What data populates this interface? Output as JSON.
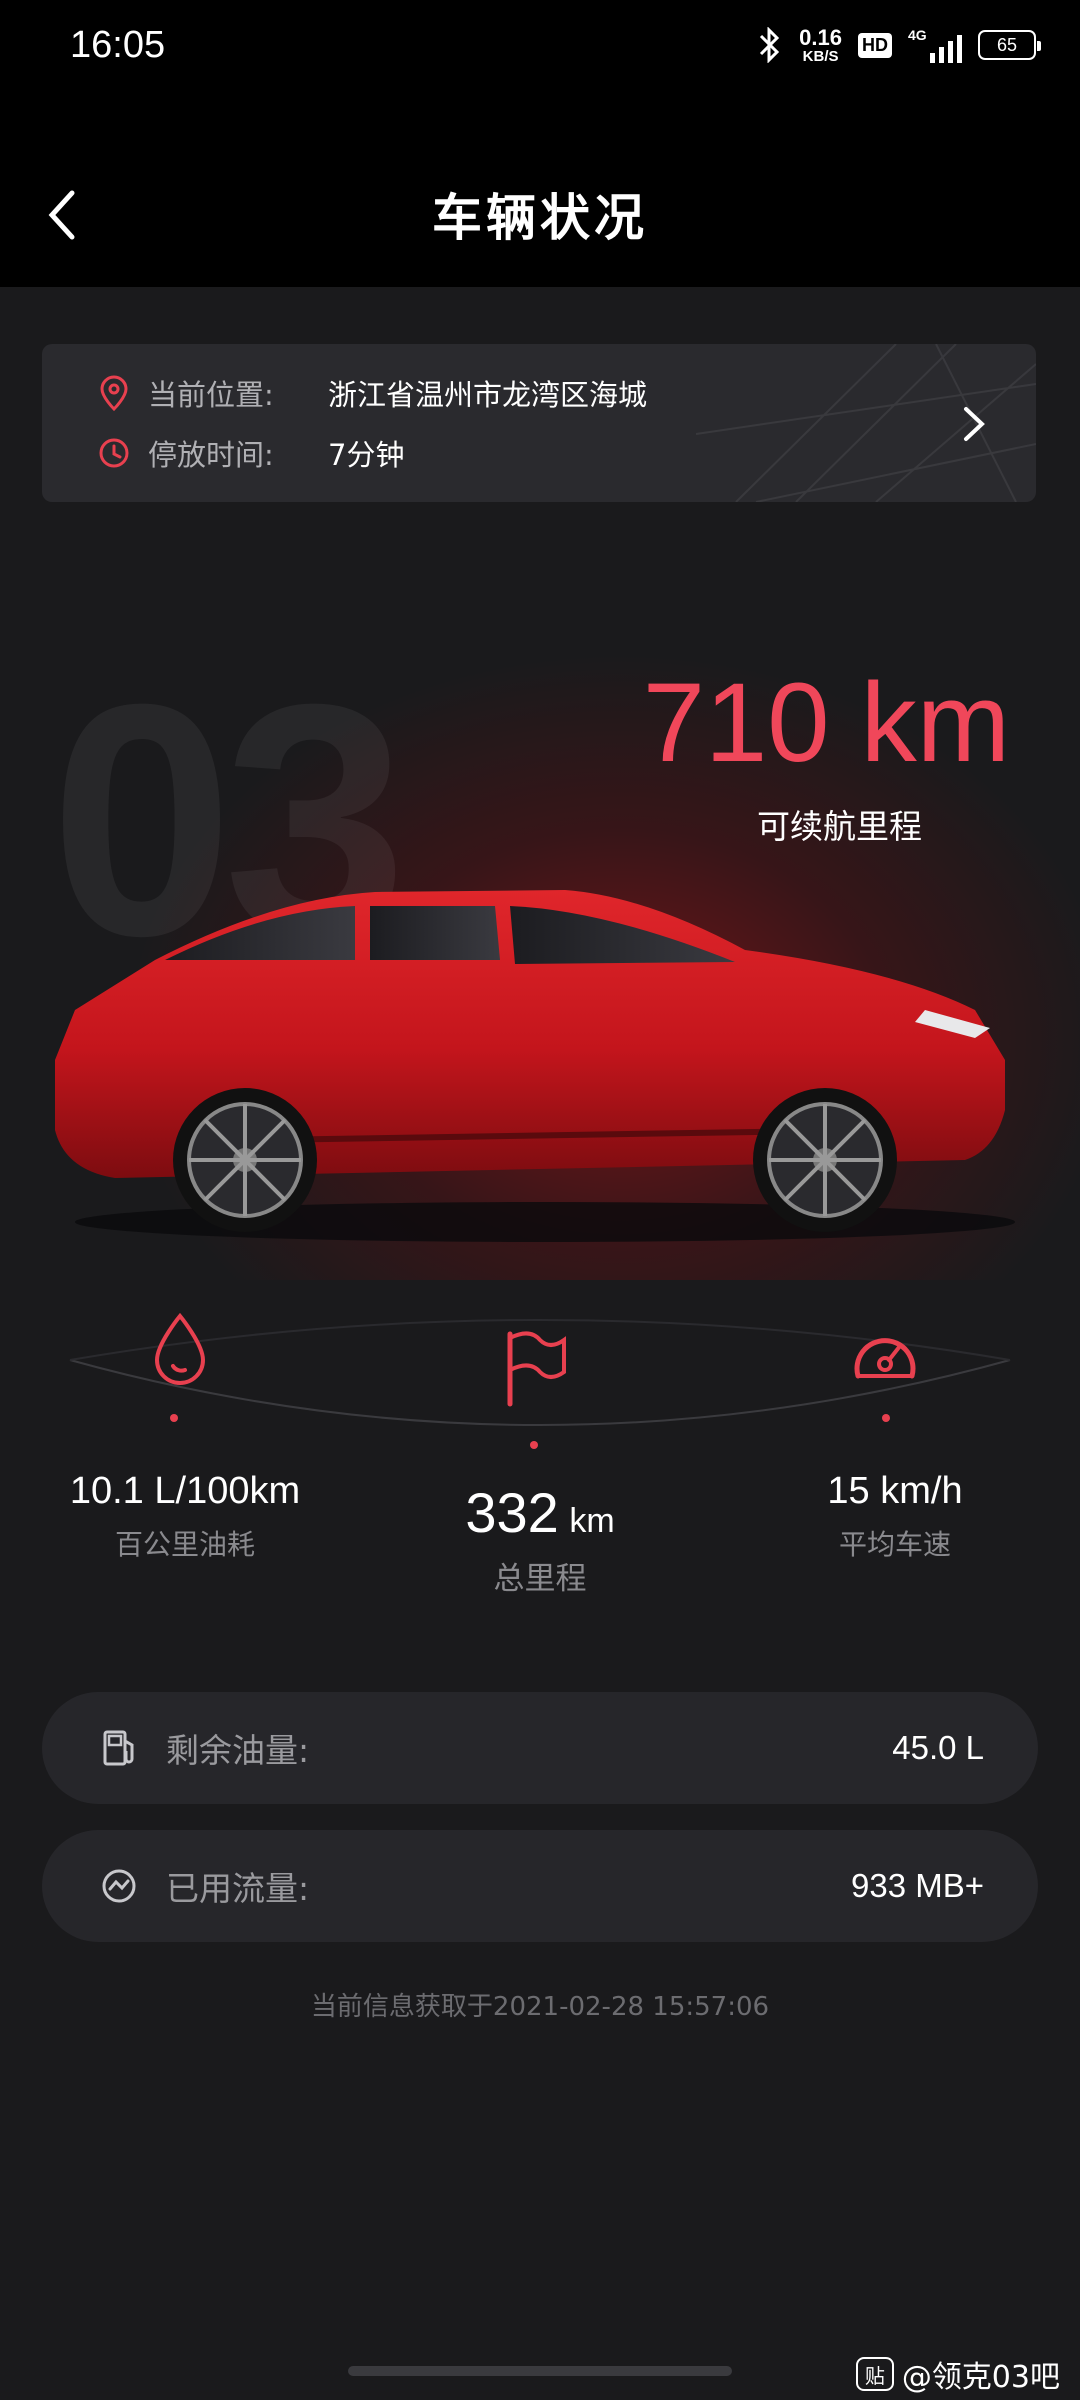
{
  "status_bar": {
    "time": "16:05",
    "net_speed_value": "0.16",
    "net_speed_unit": "KB/S",
    "hd_label": "HD",
    "signal_label": "4G",
    "battery_level": "65"
  },
  "header": {
    "title": "车辆状况",
    "back_icon": "chevron-left-icon"
  },
  "location_card": {
    "location_label": "当前位置:",
    "location_value": "浙江省温州市龙湾区海城",
    "parking_label": "停放时间:",
    "parking_value": "7分钟",
    "location_icon": "map-pin-icon",
    "clock_icon": "clock-icon",
    "arrow_icon": "chevron-right-icon"
  },
  "hero": {
    "watermark": "03",
    "range_value": "710 km",
    "range_label": "可续航里程",
    "accent_color": "#f0475a"
  },
  "stats": {
    "fuel_consumption": {
      "value": "10.1",
      "unit": "L/100km",
      "label": "百公里油耗",
      "icon": "droplet-icon"
    },
    "total_mileage": {
      "value": "332",
      "unit": "km",
      "label": "总里程",
      "icon": "flag-icon"
    },
    "avg_speed": {
      "value": "15",
      "unit": "km/h",
      "label": "平均车速",
      "icon": "speedometer-icon"
    }
  },
  "pills": {
    "fuel_remaining": {
      "label": "剩余油量:",
      "value": "45.0 L",
      "icon": "fuel-pump-icon"
    },
    "data_used": {
      "label": "已用流量:",
      "value": "933 MB+",
      "icon": "data-usage-icon"
    }
  },
  "footnote": "当前信息获取于2021-02-28 15:57:06",
  "credit": {
    "badge": "贴",
    "text": "@领克03吧"
  }
}
